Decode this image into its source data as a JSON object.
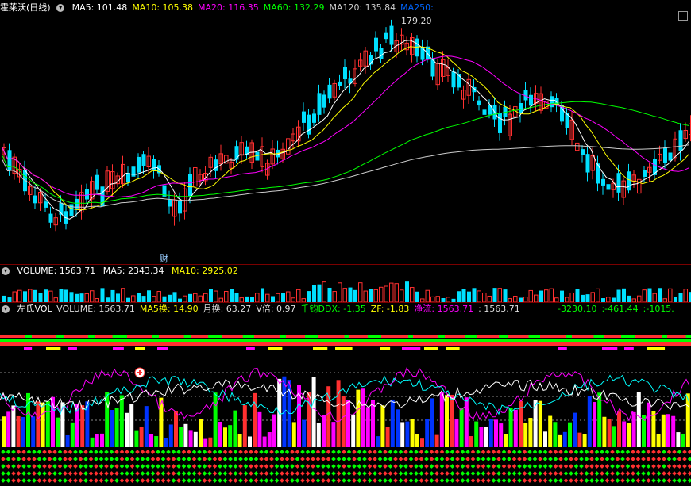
{
  "main": {
    "title": "霍莱沃(日线)",
    "ma_labels": [
      {
        "text": "MA5: 101.48",
        "color": "#ffffff"
      },
      {
        "text": "MA10: 105.38",
        "color": "#ffff00"
      },
      {
        "text": "MA20: 116.35",
        "color": "#ff00ff"
      },
      {
        "text": "MA60: 132.29",
        "color": "#00ff00"
      },
      {
        "text": "MA120: 135.84",
        "color": "#cccccc"
      },
      {
        "text": "MA250:",
        "color": "#0066ff"
      }
    ],
    "high_label": "179.20",
    "cai_badge": "财"
  },
  "volume_bar": {
    "title": "VOLUME: 1563.71",
    "ma5": "MA5: 2343.34",
    "ma10": "MA10: 2925.02"
  },
  "indicator_bar": {
    "title": "左氏VOL",
    "items": [
      {
        "text": "VOLUME: 1563.71",
        "color": "#dddddd"
      },
      {
        "text": "MA5换: 14.90",
        "color": "#ffff00"
      },
      {
        "text": "月换: 63.27",
        "color": "#dddddd"
      },
      {
        "text": "V倍: 0.97",
        "color": "#dddddd"
      },
      {
        "text": "千钧DDX: -1.35",
        "color": "#00ff00"
      },
      {
        "text": "ZF: -1.83",
        "color": "#ffff00"
      },
      {
        "text": "净流: 1563.71",
        "color": "#ff00ff"
      },
      {
        "text": ": 1563.71",
        "color": "#dddddd"
      }
    ],
    "right_values": [
      {
        "text": "-3230.10",
        "color": "#00ff00"
      },
      {
        "text": ":-461.44",
        "color": "#00ff00"
      },
      {
        "text": ":-1015.",
        "color": "#00ff00"
      }
    ]
  },
  "colors": {
    "up": "#ff3030",
    "down": "#00e0ff",
    "ma5": "#ffffff",
    "ma10": "#ffff00",
    "ma20": "#ff00ff",
    "ma60": "#00ff00",
    "ma120": "#cccccc"
  }
}
